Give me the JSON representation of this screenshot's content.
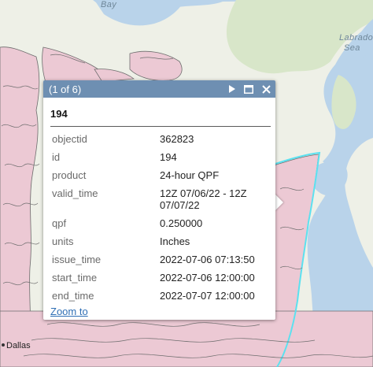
{
  "map": {
    "labels": {
      "bay": "Bay",
      "labrador_1": "Labrado",
      "labrador_2": "Sea",
      "city": "Dallas"
    },
    "colors": {
      "water": "#b9d3ea",
      "land": "#eef0e7",
      "land_green": "#d8e6c9",
      "qpf_fill": "#ecc9d4",
      "qpf_outline": "#6d6d6d",
      "highlight": "#5ce1f0"
    }
  },
  "popup": {
    "pager": "(1 of 6)",
    "icons": {
      "next": "next-triangle-icon",
      "maximize": "maximize-icon",
      "close": "close-icon"
    },
    "title": "194",
    "attributes": [
      {
        "name": "objectid",
        "value": "362823"
      },
      {
        "name": "id",
        "value": "194"
      },
      {
        "name": "product",
        "value": "24-hour QPF"
      },
      {
        "name": "valid_time",
        "value_lines": [
          "12Z 07/06/22 - 12Z",
          "07/07/22"
        ]
      },
      {
        "name": "qpf",
        "value": "0.250000"
      },
      {
        "name": "units",
        "value": "Inches"
      },
      {
        "name": "issue_time",
        "value": "2022-07-06 07:13:50"
      },
      {
        "name": "start_time",
        "value": "2022-07-06 12:00:00"
      },
      {
        "name": "end_time",
        "value": "2022-07-07 12:00:00"
      }
    ],
    "zoom_link": "Zoom to",
    "colors": {
      "header_bg": "#6e8fb2",
      "link": "#2f6fb5"
    }
  }
}
